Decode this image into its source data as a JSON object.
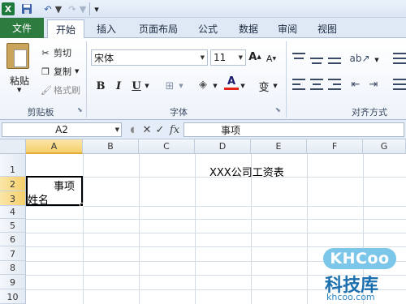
{
  "quick_access": {
    "app_icon": "excel-logo-icon",
    "app_icon_text": "X",
    "save_icon": "save-icon",
    "undo_icon": "undo-icon",
    "redo_icon": "redo-icon",
    "customize_icon": "customize-qat-icon"
  },
  "tabs": [
    {
      "label": "文件"
    },
    {
      "label": "开始"
    },
    {
      "label": "插入"
    },
    {
      "label": "页面布局"
    },
    {
      "label": "公式"
    },
    {
      "label": "数据"
    },
    {
      "label": "审阅"
    },
    {
      "label": "视图"
    }
  ],
  "active_tab": "开始",
  "ribbon": {
    "clipboard": {
      "group_label": "剪贴板",
      "paste_label": "粘贴",
      "cut_label": "剪切",
      "copy_label": "复制",
      "format_painter_label": "格式刷"
    },
    "font": {
      "group_label": "字体",
      "font_name": "宋体",
      "font_size": "11",
      "grow_label": "A",
      "shrink_label": "A",
      "bold_label": "B",
      "italic_label": "I",
      "underline_label": "U",
      "font_color_label": "A",
      "phonetic_label": "变"
    },
    "alignment": {
      "group_label": "对齐方式"
    }
  },
  "formula_bar": {
    "name_box": "A2",
    "fx_label": "fx",
    "formula": "事项"
  },
  "grid": {
    "columns": [
      "A",
      "B",
      "C",
      "D",
      "E",
      "F",
      "G"
    ],
    "rows": [
      "1",
      "2",
      "3",
      "4",
      "5",
      "6",
      "7",
      "8",
      "9",
      "10"
    ],
    "selected_cell": "A2",
    "cells": {
      "D1": "XXX公司工资表",
      "A2_top": "事项",
      "A2_bottom": "姓名"
    }
  },
  "watermark": {
    "logo": "KHCoo",
    "name": "科技库",
    "url": "khcoo.com"
  }
}
